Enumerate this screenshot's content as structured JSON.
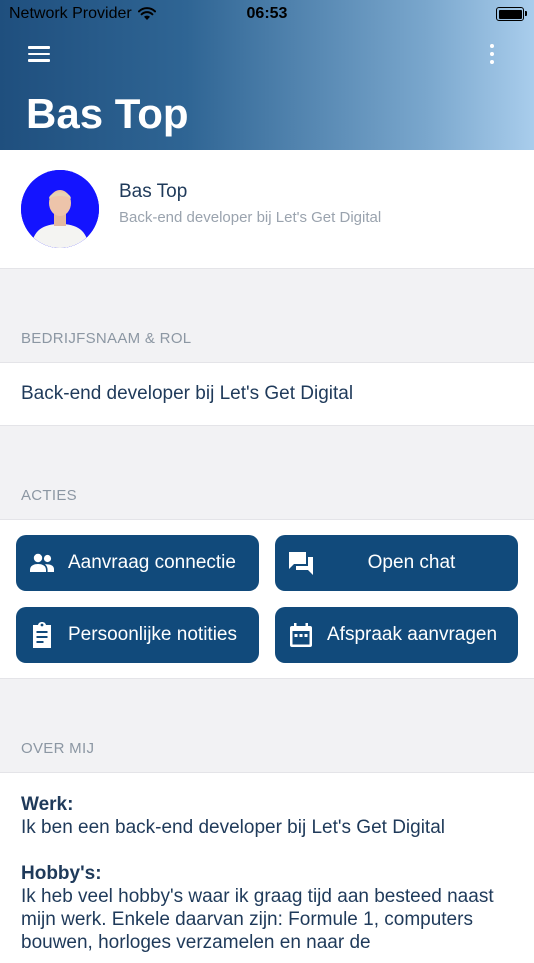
{
  "status_bar": {
    "carrier": "Network Provider",
    "time": "06:53"
  },
  "header": {
    "title": "Bas Top"
  },
  "profile": {
    "name": "Bas Top",
    "subtitle": "Back-end developer bij Let's Get Digital"
  },
  "sections": {
    "company": {
      "label": "BEDRIJFSNAAM & ROL",
      "value": "Back-end developer bij Let's Get Digital"
    },
    "actions": {
      "label": "ACTIES",
      "buttons": [
        {
          "label": "Aanvraag connectie",
          "icon": "people-icon"
        },
        {
          "label": "Open chat",
          "icon": "chat-icon"
        },
        {
          "label": "Persoonlijke notities",
          "icon": "clipboard-icon"
        },
        {
          "label": "Afspraak aanvragen",
          "icon": "calendar-icon"
        }
      ]
    },
    "about": {
      "label": "OVER MIJ",
      "work_heading": "Werk:",
      "work_text": "Ik ben een back-end developer bij Let's Get Digital",
      "hobby_heading": "Hobby's:",
      "hobby_text": "Ik heb veel hobby's waar ik graag tijd aan besteed naast mijn werk. Enkele daarvan zijn: Formule 1, computers bouwen, horloges verzamelen en naar de"
    }
  },
  "colors": {
    "header_start": "#1f4f7e",
    "header_end": "#a9cdec",
    "button": "#114a7b",
    "avatar_bg": "#1414ff"
  }
}
